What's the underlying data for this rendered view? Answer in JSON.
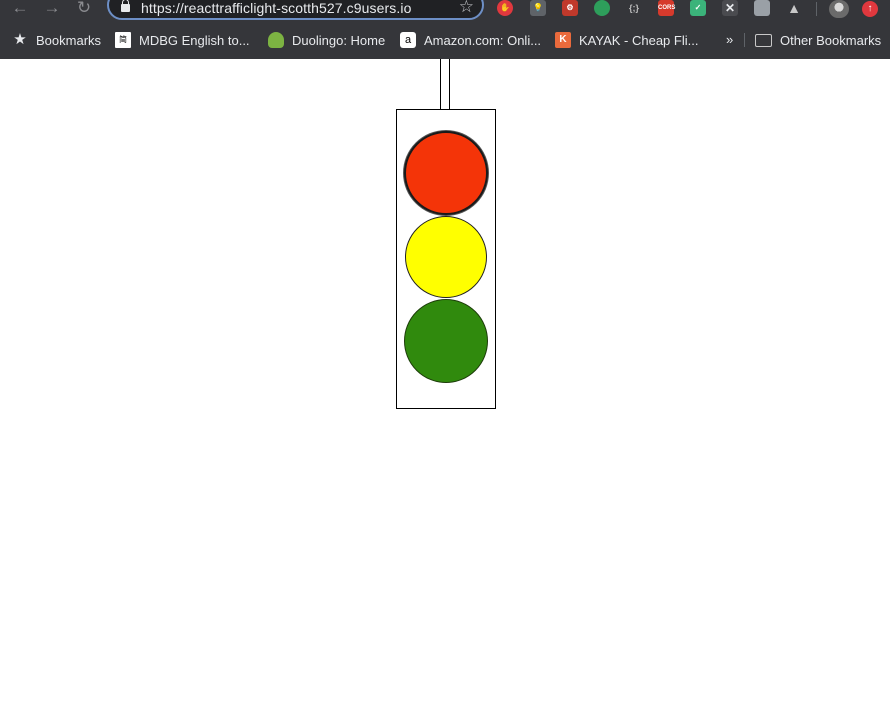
{
  "browser": {
    "url": "https://reacttrafficlight-scotth527.c9users.io",
    "nav": {
      "back_icon": "←",
      "forward_icon": "→",
      "reload_icon": "↻"
    },
    "star_icon": "☆",
    "extensions": [
      {
        "name": "ext-stop-icon",
        "glyph": "✋"
      },
      {
        "name": "ext-bulb-icon",
        "glyph": "💡"
      },
      {
        "name": "ext-bug-icon",
        "glyph": "⚙"
      },
      {
        "name": "ext-leaf-icon",
        "glyph": ""
      },
      {
        "name": "ext-code-icon",
        "glyph": "{;}"
      },
      {
        "name": "ext-cors-icon",
        "glyph": "CORS"
      },
      {
        "name": "ext-save-icon",
        "glyph": "✓"
      },
      {
        "name": "ext-cross-icon",
        "glyph": "✕"
      },
      {
        "name": "ext-chat-icon",
        "glyph": ""
      },
      {
        "name": "ext-drive-icon",
        "glyph": "▲"
      }
    ],
    "update_glyph": "↑"
  },
  "bookmarks": {
    "items": [
      {
        "label": "Bookmarks",
        "icon": "★"
      },
      {
        "label": "MDBG English to...",
        "icon": "简"
      },
      {
        "label": "Duolingo: Home",
        "icon": ""
      },
      {
        "label": "Amazon.com: Onli...",
        "icon": "a"
      },
      {
        "label": "KAYAK - Cheap Fli...",
        "icon": "K"
      }
    ],
    "more_label": "»",
    "other_label": "Other Bookmarks"
  },
  "traffic_light": {
    "lights": [
      {
        "name": "red",
        "color": "#f43408",
        "active": true
      },
      {
        "name": "yellow",
        "color": "#ffff00",
        "active": false
      },
      {
        "name": "green",
        "color": "#308a0d",
        "active": false
      }
    ],
    "housing_color": "#ffffff",
    "outline_color": "#000000"
  }
}
